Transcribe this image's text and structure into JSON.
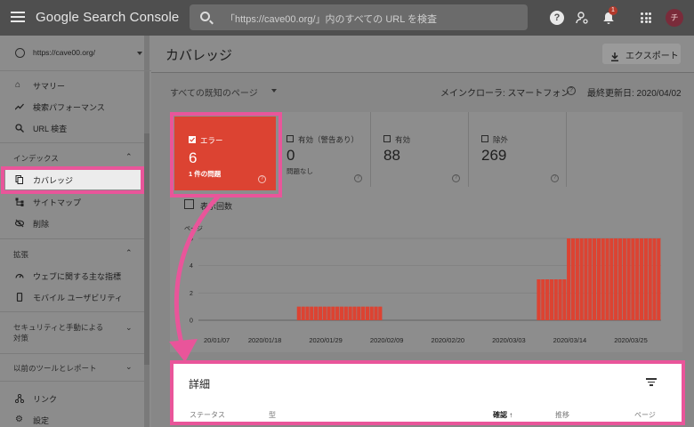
{
  "app": {
    "title": "Google Search Console"
  },
  "search": {
    "placeholder": "「https://cave00.org/」内のすべての URL を検査"
  },
  "topbar": {
    "notification_count": "1",
    "avatar_letter": "チ"
  },
  "sidebar": {
    "property": "https://cave00.org/",
    "items_top": [
      {
        "label": "サマリー",
        "icon": "home-icon"
      },
      {
        "label": "検索パフォーマンス",
        "icon": "trending-icon"
      },
      {
        "label": "URL 検査",
        "icon": "search-icon"
      }
    ],
    "section_index": "インデックス",
    "index_items": [
      {
        "label": "カバレッジ",
        "icon": "file-copy-icon",
        "active": true
      },
      {
        "label": "サイトマップ",
        "icon": "sitemap-icon"
      },
      {
        "label": "削除",
        "icon": "visibility-off-icon"
      }
    ],
    "section_enhancements": "拡張",
    "enh_items": [
      {
        "label": "ウェブに関する主な指標",
        "icon": "speed-icon"
      },
      {
        "label": "モバイル ユーザビリティ",
        "icon": "phone-icon"
      }
    ],
    "section_security_line1": "セキュリティと手動による",
    "section_security_line2": "対策",
    "section_legacy": "以前のツールとレポート",
    "bottom_items": [
      {
        "label": "リンク",
        "icon": "link-icon"
      },
      {
        "label": "設定",
        "icon": "gear-icon"
      }
    ]
  },
  "page": {
    "title": "カバレッジ",
    "export_label": "エクスポート",
    "filter_label": "すべての既知のページ",
    "crawler": "メインクローラ: スマートフォン",
    "updated": "最終更新日: 2020/04/02"
  },
  "stats": [
    {
      "label": "エラー",
      "value": "6",
      "sub": "1 件の問題",
      "checked": true
    },
    {
      "label": "有効（警告あり）",
      "value": "0",
      "sub": "問題なし",
      "checked": false
    },
    {
      "label": "有効",
      "value": "88",
      "sub": "",
      "checked": false
    },
    {
      "label": "除外",
      "value": "269",
      "sub": "",
      "checked": false
    }
  ],
  "show_count_label": "表示回数",
  "details": {
    "title": "詳細",
    "columns": [
      "ステータス",
      "型",
      "確認 ↑",
      "推移",
      "ページ"
    ]
  },
  "colors": {
    "error": "#dc4332",
    "highlight": "#e9559a"
  },
  "chart_data": {
    "type": "bar",
    "ylabel": "ページ",
    "ylim": [
      0,
      6
    ],
    "yticks": [
      "0",
      "2",
      "4",
      "6"
    ],
    "xticks": [
      "2020/01/07",
      "2020/01/18",
      "2020/01/29",
      "2020/02/09",
      "2020/02/20",
      "2020/03/03",
      "2020/03/14",
      "2020/03/25"
    ],
    "xtick_display": [
      "20/01/07",
      "2020/01/18",
      "2020/01/29",
      "2020/02/09",
      "2020/02/20",
      "2020/03/03",
      "2020/03/14",
      "2020/03/25"
    ],
    "series": [
      {
        "values": [
          0,
          0,
          0,
          0,
          0,
          0,
          0,
          0,
          0,
          0,
          0,
          0,
          0,
          0,
          0,
          0,
          0,
          0,
          0,
          0,
          0,
          0,
          0,
          1,
          1,
          1,
          1,
          1,
          1,
          1,
          1,
          1,
          1,
          1,
          1,
          1,
          1,
          1,
          1,
          1,
          1,
          1,
          1,
          0,
          0,
          0,
          0,
          0,
          0,
          0,
          0,
          0,
          0,
          0,
          0,
          0,
          0,
          0,
          0,
          0,
          0,
          0,
          0,
          0,
          0,
          0,
          0,
          0,
          0,
          0,
          0,
          0,
          0,
          0,
          0,
          0,
          0,
          0,
          0,
          3,
          3,
          3,
          3,
          3,
          3,
          3,
          6,
          6,
          6,
          6,
          6,
          6,
          6,
          6,
          6,
          6,
          6,
          6,
          6,
          6,
          6,
          6,
          6,
          6,
          6,
          6,
          6,
          6
        ]
      }
    ]
  }
}
